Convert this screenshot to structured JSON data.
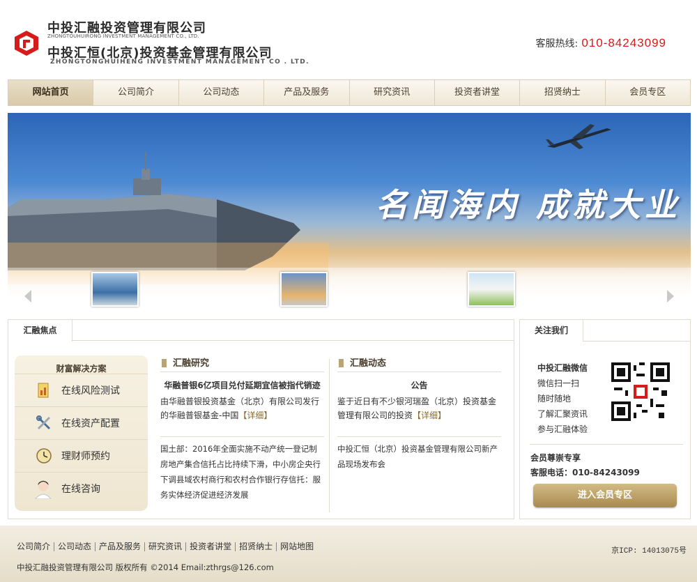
{
  "header": {
    "company_cn_1": "中投汇融投资管理有限公司",
    "company_en_1": "ZHONGTOUHUIRONG INVESTMENT MANAGEMENT CO., LTD.",
    "company_cn_2": "中投汇恒(北京)投资基金管理有限公司",
    "company_en_2": "ZHONGTONGHUIHENG  INVESTMENT MANAGEMENT CO . LTD.",
    "hotline_label": "客服热线:",
    "hotline_number": "010-84243099",
    "logo_color": "#d71a1a"
  },
  "nav": {
    "items": [
      {
        "label": "网站首页",
        "active": true
      },
      {
        "label": "公司简介"
      },
      {
        "label": "公司动态"
      },
      {
        "label": "产品及服务"
      },
      {
        "label": "研究资讯"
      },
      {
        "label": "投资者讲堂"
      },
      {
        "label": "招贤纳士"
      },
      {
        "label": "会员专区"
      }
    ]
  },
  "banner": {
    "slogan": "名闻海内 成就大业",
    "thumbnails": [
      "office-building",
      "aircraft-carrier",
      "family-car"
    ],
    "prev_icon": "arrow-left-icon",
    "next_icon": "arrow-right-icon"
  },
  "focus": {
    "tab_label": "汇融焦点",
    "solutions": {
      "title": "财富解决方案",
      "items": [
        {
          "label": "在线风险测试",
          "icon": "document-chart-icon"
        },
        {
          "label": "在线资产配置",
          "icon": "tools-icon"
        },
        {
          "label": "理财师预约",
          "icon": "clock-icon"
        },
        {
          "label": "在线咨询",
          "icon": "service-agent-icon"
        }
      ]
    },
    "research": {
      "title": "汇融研究",
      "headline": "华融普银6亿项目兑付延期宜信被指代销迹",
      "summary": "由华融普银投资基金（北京）有限公司发行的华融普银基金-中国",
      "more": "【详细】",
      "item2": "国土部：2016年全面实施不动产统一登记制房地产集合信托占比持续下滑，中小房企央行下调县域农村商行和农村合作银行存信托：服务实体经济促进经济发展"
    },
    "news": {
      "title": "汇融动态",
      "headline": "公告",
      "summary": "鉴于近日有不少银河瑞盈（北京）投资基金管理有限公司的投资",
      "more": "【详细】",
      "item2": "中投汇恒（北京）投资基金管理有限公司新产品现场发布会"
    }
  },
  "follow": {
    "tab_label": "关注我们",
    "wechat_title": "中投汇融微信",
    "lines": [
      "微信扫一扫",
      "随时随地",
      "了解汇聚资讯",
      "参与汇融体验"
    ],
    "member_title": "会员尊崇专享",
    "member_phone": "客服电话：010-84243099",
    "member_button": "进入会员专区"
  },
  "footer": {
    "links": [
      "公司简介",
      "公司动态",
      "产品及服务",
      "研究资讯",
      "投资者讲堂",
      "招贤纳士",
      "网站地图"
    ],
    "icp": "京ICP: 14013075号",
    "copyright": "中投汇融投资管理有限公司 版权所有 ©2014 Email:zthrgs@126.com"
  }
}
